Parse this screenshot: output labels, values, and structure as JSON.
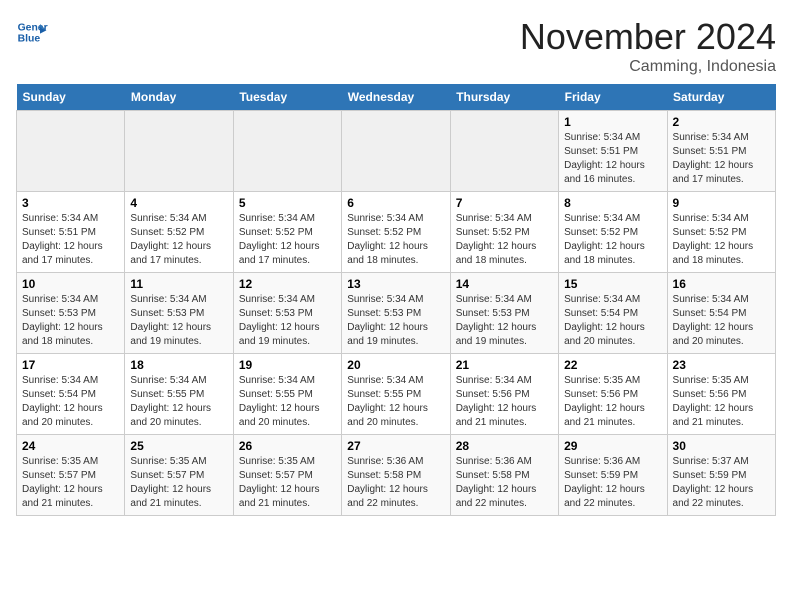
{
  "header": {
    "logo_line1": "General",
    "logo_line2": "Blue",
    "month": "November 2024",
    "location": "Camming, Indonesia"
  },
  "weekdays": [
    "Sunday",
    "Monday",
    "Tuesday",
    "Wednesday",
    "Thursday",
    "Friday",
    "Saturday"
  ],
  "weeks": [
    [
      {
        "day": "",
        "info": ""
      },
      {
        "day": "",
        "info": ""
      },
      {
        "day": "",
        "info": ""
      },
      {
        "day": "",
        "info": ""
      },
      {
        "day": "",
        "info": ""
      },
      {
        "day": "1",
        "info": "Sunrise: 5:34 AM\nSunset: 5:51 PM\nDaylight: 12 hours\nand 16 minutes."
      },
      {
        "day": "2",
        "info": "Sunrise: 5:34 AM\nSunset: 5:51 PM\nDaylight: 12 hours\nand 17 minutes."
      }
    ],
    [
      {
        "day": "3",
        "info": "Sunrise: 5:34 AM\nSunset: 5:51 PM\nDaylight: 12 hours\nand 17 minutes."
      },
      {
        "day": "4",
        "info": "Sunrise: 5:34 AM\nSunset: 5:52 PM\nDaylight: 12 hours\nand 17 minutes."
      },
      {
        "day": "5",
        "info": "Sunrise: 5:34 AM\nSunset: 5:52 PM\nDaylight: 12 hours\nand 17 minutes."
      },
      {
        "day": "6",
        "info": "Sunrise: 5:34 AM\nSunset: 5:52 PM\nDaylight: 12 hours\nand 18 minutes."
      },
      {
        "day": "7",
        "info": "Sunrise: 5:34 AM\nSunset: 5:52 PM\nDaylight: 12 hours\nand 18 minutes."
      },
      {
        "day": "8",
        "info": "Sunrise: 5:34 AM\nSunset: 5:52 PM\nDaylight: 12 hours\nand 18 minutes."
      },
      {
        "day": "9",
        "info": "Sunrise: 5:34 AM\nSunset: 5:52 PM\nDaylight: 12 hours\nand 18 minutes."
      }
    ],
    [
      {
        "day": "10",
        "info": "Sunrise: 5:34 AM\nSunset: 5:53 PM\nDaylight: 12 hours\nand 18 minutes."
      },
      {
        "day": "11",
        "info": "Sunrise: 5:34 AM\nSunset: 5:53 PM\nDaylight: 12 hours\nand 19 minutes."
      },
      {
        "day": "12",
        "info": "Sunrise: 5:34 AM\nSunset: 5:53 PM\nDaylight: 12 hours\nand 19 minutes."
      },
      {
        "day": "13",
        "info": "Sunrise: 5:34 AM\nSunset: 5:53 PM\nDaylight: 12 hours\nand 19 minutes."
      },
      {
        "day": "14",
        "info": "Sunrise: 5:34 AM\nSunset: 5:53 PM\nDaylight: 12 hours\nand 19 minutes."
      },
      {
        "day": "15",
        "info": "Sunrise: 5:34 AM\nSunset: 5:54 PM\nDaylight: 12 hours\nand 20 minutes."
      },
      {
        "day": "16",
        "info": "Sunrise: 5:34 AM\nSunset: 5:54 PM\nDaylight: 12 hours\nand 20 minutes."
      }
    ],
    [
      {
        "day": "17",
        "info": "Sunrise: 5:34 AM\nSunset: 5:54 PM\nDaylight: 12 hours\nand 20 minutes."
      },
      {
        "day": "18",
        "info": "Sunrise: 5:34 AM\nSunset: 5:55 PM\nDaylight: 12 hours\nand 20 minutes."
      },
      {
        "day": "19",
        "info": "Sunrise: 5:34 AM\nSunset: 5:55 PM\nDaylight: 12 hours\nand 20 minutes."
      },
      {
        "day": "20",
        "info": "Sunrise: 5:34 AM\nSunset: 5:55 PM\nDaylight: 12 hours\nand 20 minutes."
      },
      {
        "day": "21",
        "info": "Sunrise: 5:34 AM\nSunset: 5:56 PM\nDaylight: 12 hours\nand 21 minutes."
      },
      {
        "day": "22",
        "info": "Sunrise: 5:35 AM\nSunset: 5:56 PM\nDaylight: 12 hours\nand 21 minutes."
      },
      {
        "day": "23",
        "info": "Sunrise: 5:35 AM\nSunset: 5:56 PM\nDaylight: 12 hours\nand 21 minutes."
      }
    ],
    [
      {
        "day": "24",
        "info": "Sunrise: 5:35 AM\nSunset: 5:57 PM\nDaylight: 12 hours\nand 21 minutes."
      },
      {
        "day": "25",
        "info": "Sunrise: 5:35 AM\nSunset: 5:57 PM\nDaylight: 12 hours\nand 21 minutes."
      },
      {
        "day": "26",
        "info": "Sunrise: 5:35 AM\nSunset: 5:57 PM\nDaylight: 12 hours\nand 21 minutes."
      },
      {
        "day": "27",
        "info": "Sunrise: 5:36 AM\nSunset: 5:58 PM\nDaylight: 12 hours\nand 22 minutes."
      },
      {
        "day": "28",
        "info": "Sunrise: 5:36 AM\nSunset: 5:58 PM\nDaylight: 12 hours\nand 22 minutes."
      },
      {
        "day": "29",
        "info": "Sunrise: 5:36 AM\nSunset: 5:59 PM\nDaylight: 12 hours\nand 22 minutes."
      },
      {
        "day": "30",
        "info": "Sunrise: 5:37 AM\nSunset: 5:59 PM\nDaylight: 12 hours\nand 22 minutes."
      }
    ]
  ]
}
